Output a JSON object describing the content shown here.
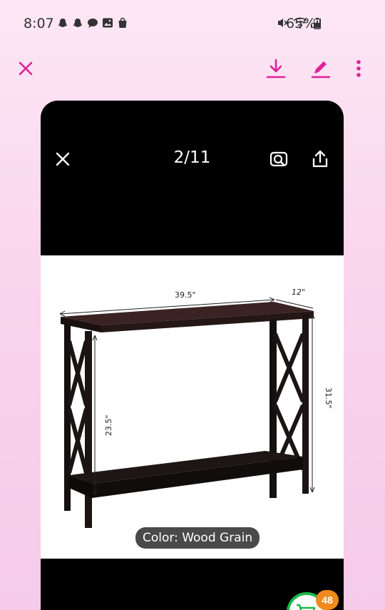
{
  "status_bar": {
    "time": "8:07",
    "battery": "65%",
    "left_icons": [
      "snapchat-icon",
      "snapchat-icon",
      "chat-bubble-icon",
      "gallery-icon",
      "shopping-bag-icon"
    ],
    "right_icons": [
      "mute-icon",
      "wifi-icon",
      "signal-icon",
      "battery-icon"
    ]
  },
  "toolbar": {
    "accent_color": "#e0219a",
    "icons": [
      "close-icon",
      "download-icon",
      "edit-icon",
      "more-vert-icon"
    ]
  },
  "viewer": {
    "page_counter": "2/11",
    "icons": [
      "close-icon",
      "visual-search-icon",
      "share-icon"
    ]
  },
  "product": {
    "dimension_width": "39.5\"",
    "dimension_depth": "12\"",
    "dimension_height": "31.5\"",
    "dimension_shelf": "23.5\"",
    "color_label": "Color: Wood Grain"
  },
  "cart": {
    "count": "48"
  }
}
